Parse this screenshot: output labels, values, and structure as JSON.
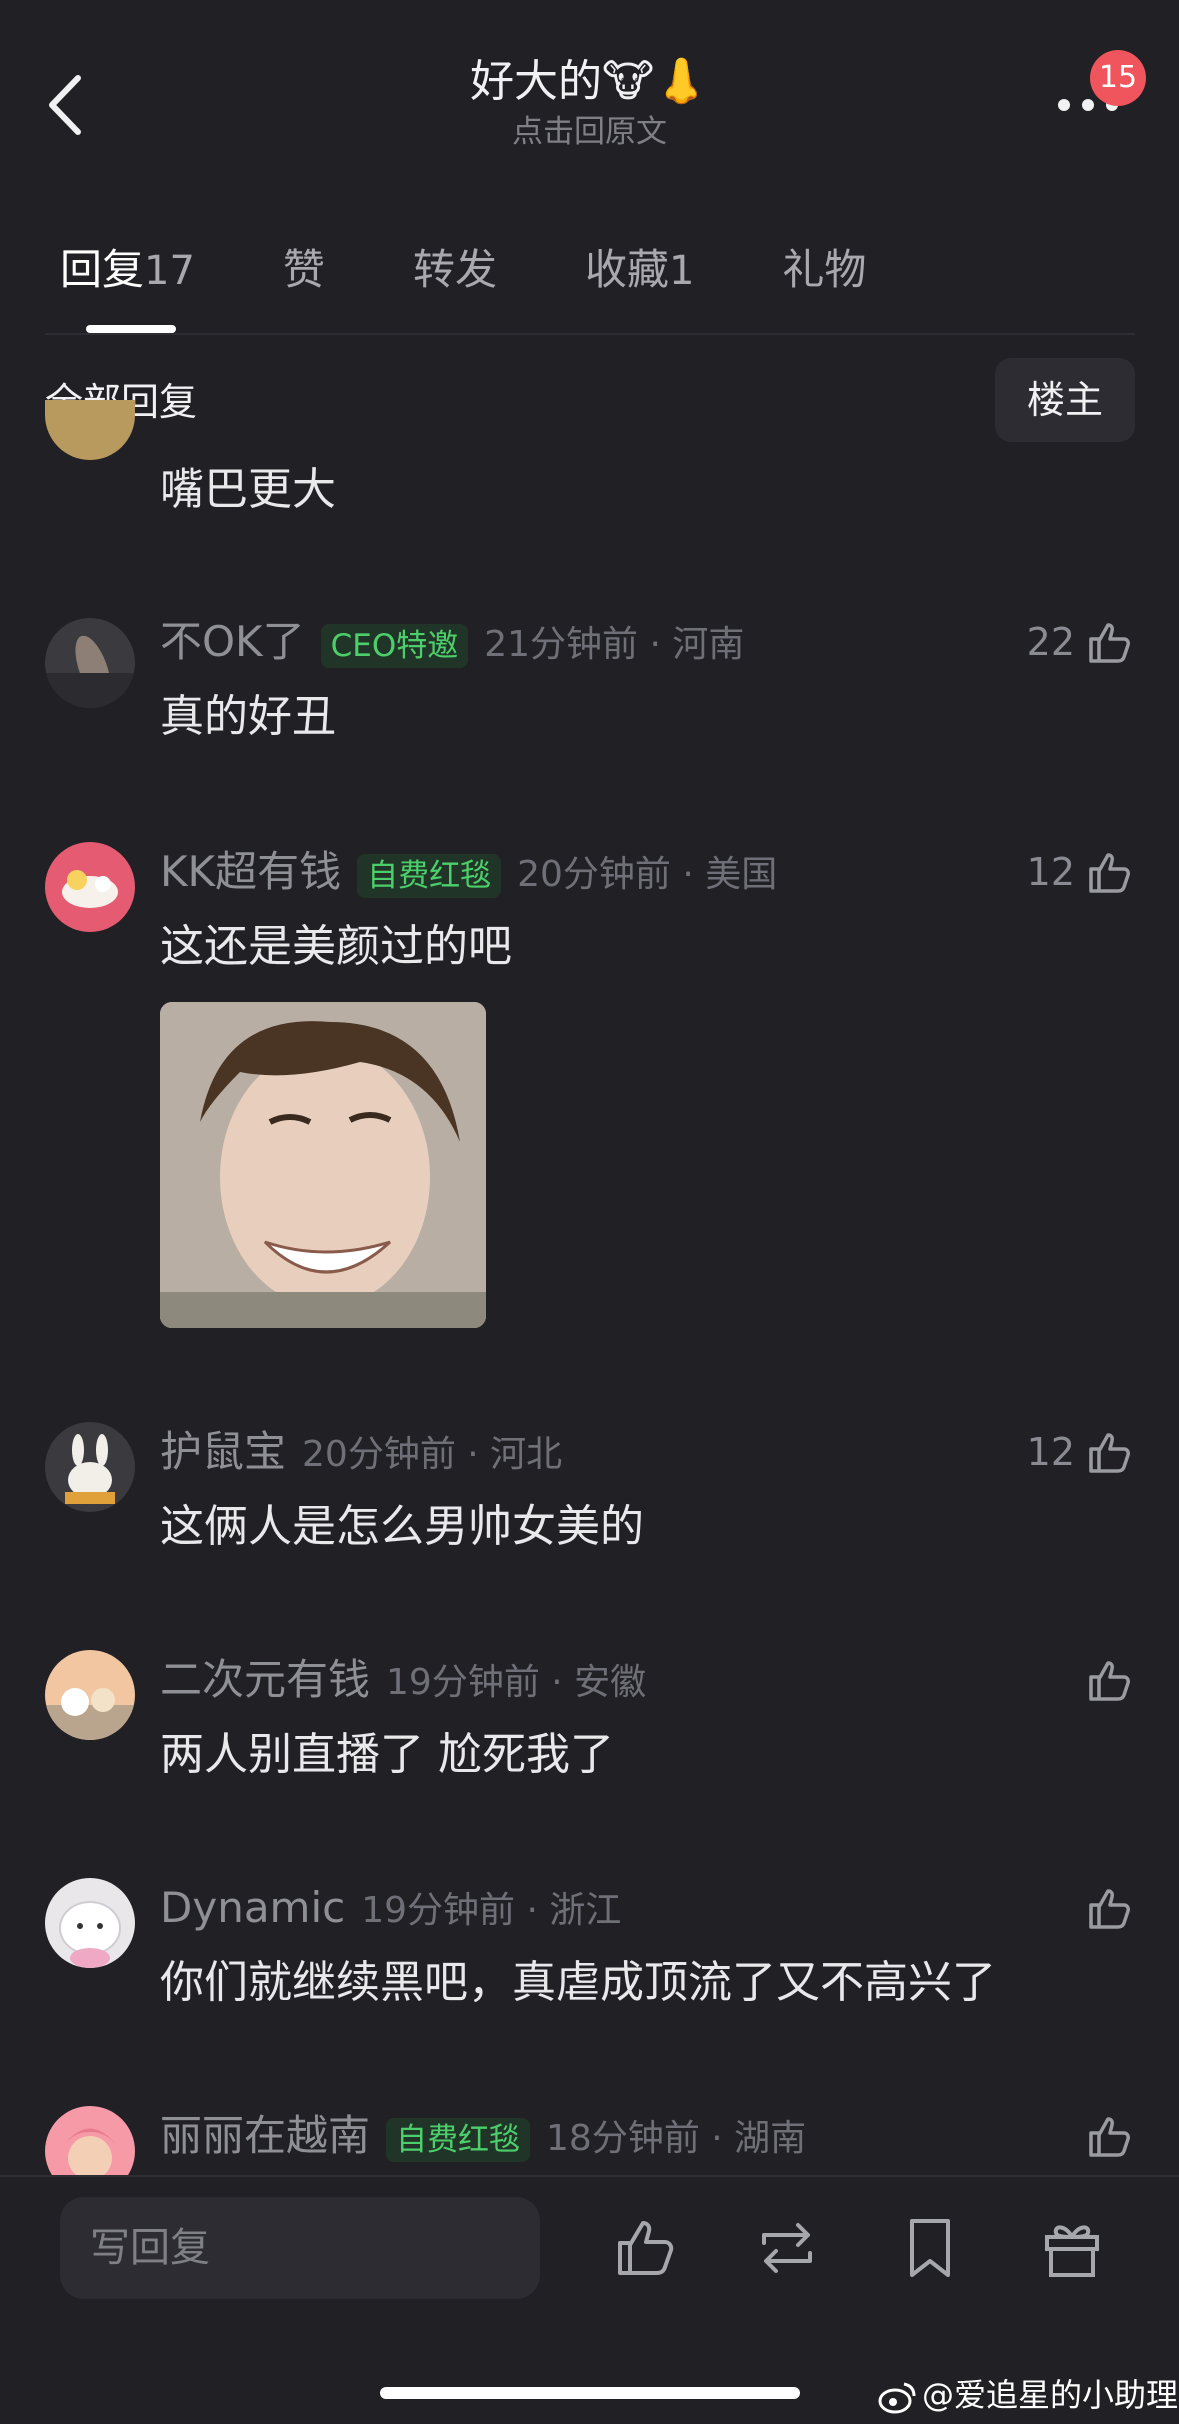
{
  "header": {
    "back_icon": "chevron-left-icon",
    "title": "好大的🐮👃",
    "subtitle": "点击回原文",
    "more_icon": "more-dots-icon",
    "badge_count": "15"
  },
  "tabs": [
    {
      "label": "回复",
      "count": "17",
      "active": true
    },
    {
      "label": "赞",
      "count": ""
    },
    {
      "label": "转发",
      "count": ""
    },
    {
      "label": "收藏",
      "count": "1"
    },
    {
      "label": "礼物",
      "count": ""
    }
  ],
  "filter": {
    "label": "全部回复",
    "owner_button": "楼主"
  },
  "partial_comment": {
    "text": "嘴巴更大"
  },
  "comments": [
    {
      "user": "不OK了",
      "tag": "CEO特邀",
      "time": "21分钟前 · 河南",
      "text": "真的好丑",
      "likes": "22"
    },
    {
      "user": "KK超有钱",
      "tag": "自费红毯",
      "time": "20分钟前 · 美国",
      "text": "这还是美颜过的吧",
      "likes": "12",
      "has_image": true
    },
    {
      "user": "护鼠宝",
      "tag": "",
      "time": "20分钟前 · 河北",
      "text": "这俩人是怎么男帅女美的",
      "likes": "12"
    },
    {
      "user": "二次元有钱",
      "tag": "",
      "time": "19分钟前 · 安徽",
      "text": "两人别直播了 尬死我了",
      "likes": ""
    },
    {
      "user": "Dynamic",
      "tag": "",
      "time": "19分钟前 · 浙江",
      "text": "你们就继续黑吧，真虐成顶流了又不高兴了",
      "likes": ""
    },
    {
      "user": "丽丽在越南",
      "tag": "自费红毯",
      "time": "18分钟前 · 湖南",
      "text": "",
      "likes": ""
    }
  ],
  "bottom_bar": {
    "reply_placeholder": "写回复",
    "icons": [
      "like-icon",
      "repost-icon",
      "bookmark-icon",
      "gift-icon"
    ]
  },
  "watermark": "@爱追星的小助理",
  "colors": {
    "background": "#212025",
    "accent_green": "#4ccf6a",
    "badge_red": "#f0555d"
  }
}
